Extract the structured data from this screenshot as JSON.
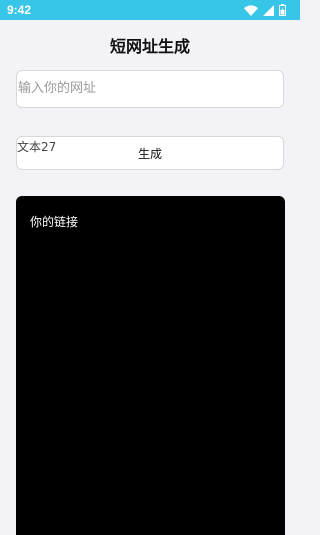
{
  "status_bar": {
    "time": "9:42",
    "icons": [
      "wifi-icon",
      "signal-icon",
      "battery-icon"
    ],
    "background": "#37c6e8"
  },
  "page": {
    "title": "短网址生成"
  },
  "url_input": {
    "placeholder": "输入你的网址",
    "value": ""
  },
  "generate": {
    "row_label": "文本27",
    "button_label": "生成"
  },
  "result": {
    "label": "你的链接",
    "background": "#000000"
  },
  "colors": {
    "app_background": "#f2f2f7",
    "accent": "#37c6e8"
  }
}
